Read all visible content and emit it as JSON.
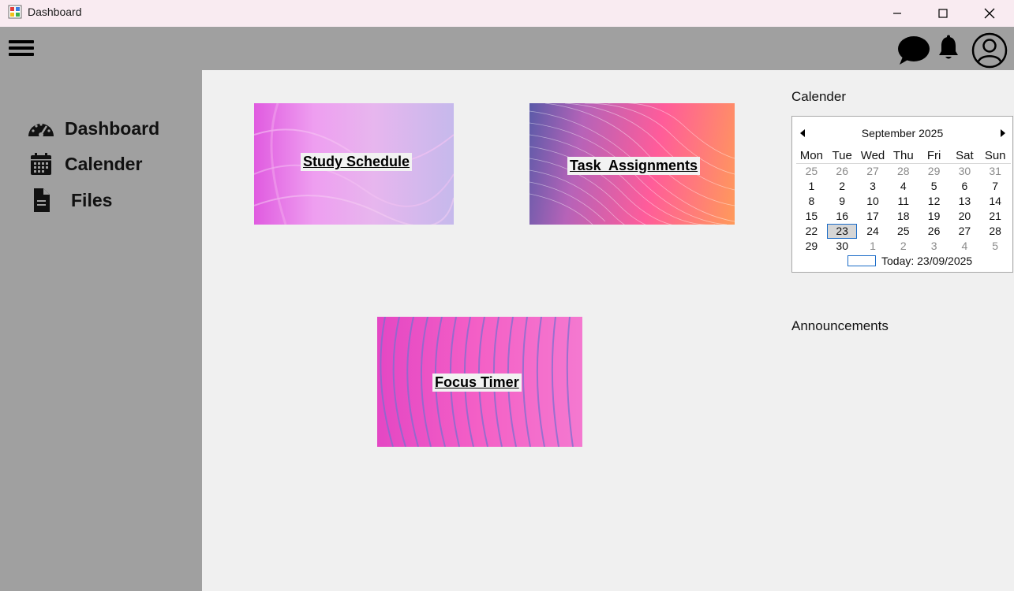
{
  "window": {
    "title": "Dashboard",
    "icon": "app-window-icon"
  },
  "header": {
    "menu_icon": "hamburger-menu-icon",
    "chat_icon": "chat-bubble-icon",
    "notification_icon": "bell-icon",
    "profile_icon": "user-circle-icon"
  },
  "sidebar": {
    "items": [
      {
        "label": "Dashboard",
        "icon": "speedometer-icon"
      },
      {
        "label": "Calender",
        "icon": "calendar-icon"
      },
      {
        "label": "Files",
        "icon": "file-icon"
      }
    ]
  },
  "cards": {
    "study": {
      "label": "Study Schedule"
    },
    "task": {
      "label": "Task  Assignments"
    },
    "focus": {
      "label": "Focus Timer"
    }
  },
  "calendar_section": {
    "heading": "Calender",
    "month": "September 2025",
    "weekdays": [
      "Mon",
      "Tue",
      "Wed",
      "Thu",
      "Fri",
      "Sat",
      "Sun"
    ],
    "weeks": [
      [
        "25",
        "26",
        "27",
        "28",
        "29",
        "30",
        "31"
      ],
      [
        "1",
        "2",
        "3",
        "4",
        "5",
        "6",
        "7"
      ],
      [
        "8",
        "9",
        "10",
        "11",
        "12",
        "13",
        "14"
      ],
      [
        "15",
        "16",
        "17",
        "18",
        "19",
        "20",
        "21"
      ],
      [
        "22",
        "23",
        "24",
        "25",
        "26",
        "27",
        "28"
      ],
      [
        "29",
        "30",
        "1",
        "2",
        "3",
        "4",
        "5"
      ]
    ],
    "selected_day": "23",
    "today_label": "Today: 23/09/2025"
  },
  "announcements": {
    "heading": "Announcements"
  },
  "colors": {
    "header_bg": "#a0a0a0",
    "titlebar_bg": "#f9ebf1",
    "main_bg": "#f0f0f0",
    "accent": "#1b6cc8"
  }
}
